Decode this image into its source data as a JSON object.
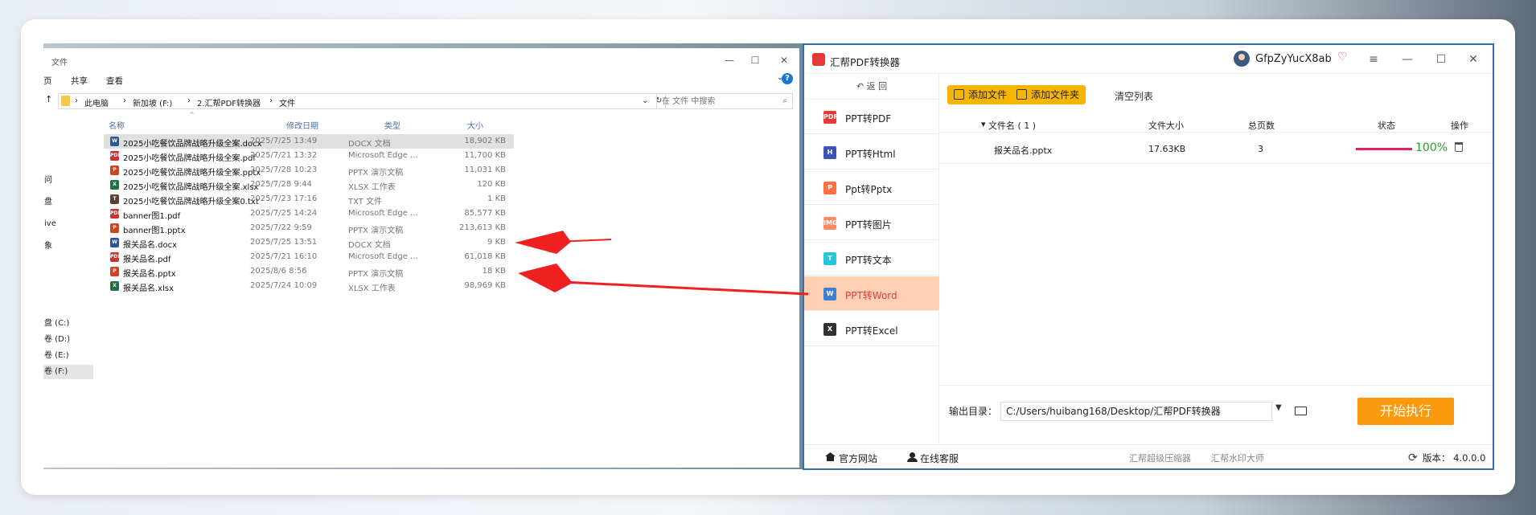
{
  "explorer": {
    "title": "文件",
    "ribbon": [
      "页",
      "共享",
      "查看"
    ],
    "address": [
      "此电脑",
      "新加坡 (F:)",
      "2.汇帮PDF转换器",
      "文件"
    ],
    "search_placeholder": "在 文件 中搜索",
    "nav_items": [
      "问",
      "盘",
      "ive",
      "象",
      "盘 (C:)",
      "卷 (D:)",
      "卷 (E:)",
      "卷 (F:)"
    ],
    "columns": {
      "name": "名称",
      "date": "修改日期",
      "type": "类型",
      "size": "大小"
    },
    "files": [
      {
        "name": "2025小吃餐饮品牌战略升级全案.docx",
        "date": "2025/7/25 13:49",
        "type": "DOCX 文档",
        "size": "18,902 KB",
        "icon": "W",
        "color": "#2b579a"
      },
      {
        "name": "2025小吃餐饮品牌战略升级全案.pdf",
        "date": "2025/7/21 13:32",
        "type": "Microsoft Edge ...",
        "size": "11,700 KB",
        "icon": "PDF",
        "color": "#d32f2f"
      },
      {
        "name": "2025小吃餐饮品牌战略升级全案.pptx",
        "date": "2025/7/28 10:23",
        "type": "PPTX 演示文稿",
        "size": "11,031 KB",
        "icon": "P",
        "color": "#d04423"
      },
      {
        "name": "2025小吃餐饮品牌战略升级全案.xlsx",
        "date": "2025/7/28 9:44",
        "type": "XLSX 工作表",
        "size": "120 KB",
        "icon": "X",
        "color": "#217346"
      },
      {
        "name": "2025小吃餐饮品牌战略升级全案0.txt",
        "date": "2025/7/23 17:16",
        "type": "TXT 文件",
        "size": "1 KB",
        "icon": "T",
        "color": "#5d4037"
      },
      {
        "name": "banner图1.pdf",
        "date": "2025/7/25 14:24",
        "type": "Microsoft Edge ...",
        "size": "85,577 KB",
        "icon": "PDF",
        "color": "#d32f2f"
      },
      {
        "name": "banner图1.pptx",
        "date": "2025/7/22 9:59",
        "type": "PPTX 演示文稿",
        "size": "213,613 KB",
        "icon": "P",
        "color": "#d04423"
      },
      {
        "name": "报关品名.docx",
        "date": "2025/7/25 13:51",
        "type": "DOCX 文档",
        "size": "9 KB",
        "icon": "W",
        "color": "#2b579a"
      },
      {
        "name": "报关品名.pdf",
        "date": "2025/7/21 16:10",
        "type": "Microsoft Edge ...",
        "size": "61,018 KB",
        "icon": "PDF",
        "color": "#d32f2f"
      },
      {
        "name": "报关品名.pptx",
        "date": "2025/8/6 8:56",
        "type": "PPTX 演示文稿",
        "size": "18 KB",
        "icon": "P",
        "color": "#d04423"
      },
      {
        "name": "报关品名.xlsx",
        "date": "2025/7/24 10:09",
        "type": "XLSX 工作表",
        "size": "98,969 KB",
        "icon": "X",
        "color": "#217346"
      }
    ]
  },
  "app": {
    "title": "汇帮PDF转换器",
    "username": "GfpZyYucX8ab",
    "back_label": "返 回",
    "menu": [
      {
        "label": "PPT转PDF",
        "icon": "PDF",
        "color": "#e53935"
      },
      {
        "label": "PPT转Html",
        "icon": "H",
        "color": "#3f51b5"
      },
      {
        "label": "Ppt转Pptx",
        "icon": "P",
        "color": "#ff7043"
      },
      {
        "label": "PPT转图片",
        "icon": "IMG",
        "color": "#ff8a65"
      },
      {
        "label": "PPT转文本",
        "icon": "T",
        "color": "#26c6da"
      },
      {
        "label": "PPT转Word",
        "icon": "W",
        "color": "#3f7fd6"
      },
      {
        "label": "PPT转Excel",
        "icon": "X",
        "color": "#333333"
      }
    ],
    "toolbar": {
      "add_file": "添加文件",
      "add_folder": "添加文件夹",
      "clear": "清空列表"
    },
    "table": {
      "headers": {
        "name": "文件名 ( 1 )",
        "size": "文件大小",
        "pages": "总页数",
        "status": "状态",
        "action": "操作"
      },
      "row": {
        "name": "报关品名.pptx",
        "size": "17.63KB",
        "pages": "3",
        "progress": 1.0,
        "percent": "100%"
      }
    },
    "output": {
      "label": "输出目录：",
      "path": "C:/Users/huibang168/Desktop/汇帮PDF转换器"
    },
    "start_label": "开始执行",
    "footer": {
      "website": "官方网站",
      "service": "在线客服",
      "compress": "汇帮超级压缩器",
      "watermark": "汇帮水印大师",
      "version": "版本： 4.0.0.0"
    }
  },
  "colors": {
    "accent": "#f7b500",
    "start": "#fa9a0c",
    "active_bg": "#ffd0b3",
    "arrow": "#f02020"
  }
}
